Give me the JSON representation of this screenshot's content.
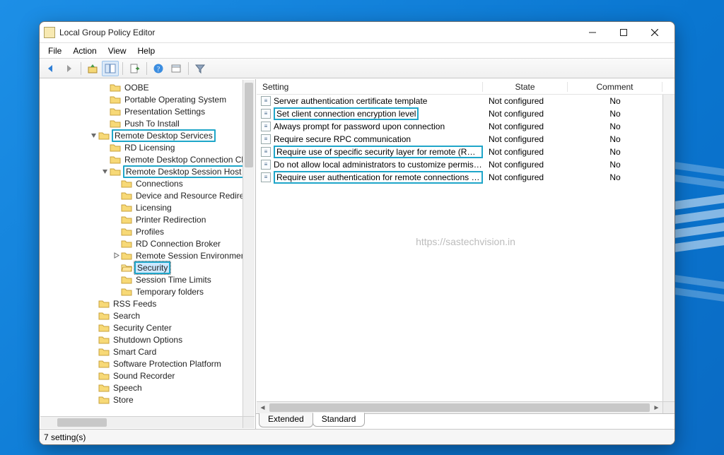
{
  "window": {
    "title": "Local Group Policy Editor"
  },
  "menubar": [
    "File",
    "Action",
    "View",
    "Help"
  ],
  "toolbar": [
    {
      "name": "back-icon"
    },
    {
      "name": "forward-icon"
    },
    {
      "sep": true
    },
    {
      "name": "up-icon"
    },
    {
      "name": "show-hide-tree-icon",
      "pressed": true
    },
    {
      "sep": true
    },
    {
      "name": "export-list-icon"
    },
    {
      "sep": true
    },
    {
      "name": "help-icon"
    },
    {
      "name": "properties-icon"
    },
    {
      "sep": true
    },
    {
      "name": "filter-icon"
    }
  ],
  "tree": [
    {
      "indent": 5,
      "exp": "",
      "label": "OOBE"
    },
    {
      "indent": 5,
      "exp": "",
      "label": "Portable Operating System"
    },
    {
      "indent": 5,
      "exp": "",
      "label": "Presentation Settings"
    },
    {
      "indent": 5,
      "exp": "",
      "label": "Push To Install"
    },
    {
      "indent": 4,
      "exp": "open",
      "label": "Remote Desktop Services",
      "hl": true
    },
    {
      "indent": 5,
      "exp": "",
      "label": "RD Licensing"
    },
    {
      "indent": 5,
      "exp": "",
      "label": "Remote Desktop Connection Client"
    },
    {
      "indent": 5,
      "exp": "open",
      "label": "Remote Desktop Session Host",
      "hl": true
    },
    {
      "indent": 6,
      "exp": "",
      "label": "Connections"
    },
    {
      "indent": 6,
      "exp": "",
      "label": "Device and Resource Redirection"
    },
    {
      "indent": 6,
      "exp": "",
      "label": "Licensing"
    },
    {
      "indent": 6,
      "exp": "",
      "label": "Printer Redirection"
    },
    {
      "indent": 6,
      "exp": "",
      "label": "Profiles"
    },
    {
      "indent": 6,
      "exp": "",
      "label": "RD Connection Broker"
    },
    {
      "indent": 6,
      "exp": "closed",
      "label": "Remote Session Environment"
    },
    {
      "indent": 6,
      "exp": "",
      "label": "Security",
      "sel": true,
      "hl": true,
      "open": true
    },
    {
      "indent": 6,
      "exp": "",
      "label": "Session Time Limits"
    },
    {
      "indent": 6,
      "exp": "",
      "label": "Temporary folders"
    },
    {
      "indent": 4,
      "exp": "",
      "label": "RSS Feeds"
    },
    {
      "indent": 4,
      "exp": "",
      "label": "Search"
    },
    {
      "indent": 4,
      "exp": "",
      "label": "Security Center"
    },
    {
      "indent": 4,
      "exp": "",
      "label": "Shutdown Options"
    },
    {
      "indent": 4,
      "exp": "",
      "label": "Smart Card"
    },
    {
      "indent": 4,
      "exp": "",
      "label": "Software Protection Platform"
    },
    {
      "indent": 4,
      "exp": "",
      "label": "Sound Recorder"
    },
    {
      "indent": 4,
      "exp": "",
      "label": "Speech"
    },
    {
      "indent": 4,
      "exp": "",
      "label": "Store"
    }
  ],
  "list": {
    "headers": {
      "setting": "Setting",
      "state": "State",
      "comment": "Comment"
    },
    "rows": [
      {
        "setting": "Server authentication certificate template",
        "state": "Not configured",
        "comment": "No"
      },
      {
        "setting": "Set client connection encryption level",
        "state": "Not configured",
        "comment": "No",
        "hl": true
      },
      {
        "setting": "Always prompt for password upon connection",
        "state": "Not configured",
        "comment": "No"
      },
      {
        "setting": "Require secure RPC communication",
        "state": "Not configured",
        "comment": "No"
      },
      {
        "setting": "Require use of specific security layer for remote (RDP) conn..",
        "state": "Not configured",
        "comment": "No",
        "hl": true
      },
      {
        "setting": "Do not allow local administrators to customize permissions",
        "state": "Not configured",
        "comment": "No"
      },
      {
        "setting": "Require user authentication for remote connections by usin..",
        "state": "Not configured",
        "comment": "No",
        "hl": true
      }
    ]
  },
  "watermark": "https://sastechvision.in",
  "tabs": {
    "extended": "Extended",
    "standard": "Standard",
    "active": "standard"
  },
  "statusbar": "7 setting(s)"
}
